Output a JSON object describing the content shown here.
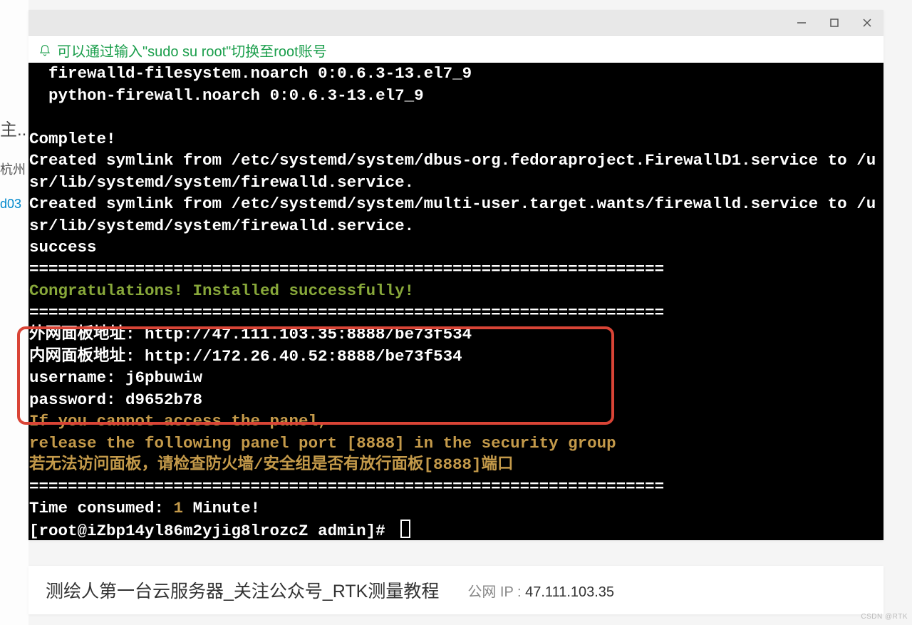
{
  "left": {
    "t1": "主..",
    "t2": "杭州",
    "t3": "d03"
  },
  "hint": "可以通过输入\"sudo su root\"切换至root账号",
  "terminal": {
    "l1": "  firewalld-filesystem.noarch 0:0.6.3-13.el7_9",
    "l2": "  python-firewall.noarch 0:0.6.3-13.el7_9",
    "blank": "",
    "complete": "Complete!",
    "sym1": "Created symlink from /etc/systemd/system/dbus-org.fedoraproject.FirewallD1.service to /usr/lib/systemd/system/firewalld.service.",
    "sym2": "Created symlink from /etc/systemd/system/multi-user.target.wants/firewalld.service to /usr/lib/systemd/system/firewalld.service.",
    "success": "success",
    "sep": "==================================================================",
    "congrats": "Congratulations! Installed successfully!",
    "ext_addr": "外网面板地址: http://47.111.103.35:8888/be73f534",
    "int_addr": "内网面板地址: http://172.26.40.52:8888/be73f534",
    "user": "username: j6pbuwiw",
    "pass": "password: d9652b78",
    "warn1": "If you cannot access the panel,",
    "warn2": "release the following panel port [8888] in the security group",
    "warn3": "若无法访问面板，请检查防火墙/安全组是否有放行面板[8888]端口",
    "time_pre": "Time consumed: ",
    "time_num": "1",
    "time_post": " Minute!",
    "prompt": "[root@iZbp14yl86m2yjig8lrozcZ admin]# "
  },
  "bottom": {
    "title": "测绘人第一台云服务器_关注公众号_RTK测量教程",
    "ip_label": "公网 IP : ",
    "ip_val": "47.111.103.35"
  },
  "watermark": "CSDN @RTK"
}
